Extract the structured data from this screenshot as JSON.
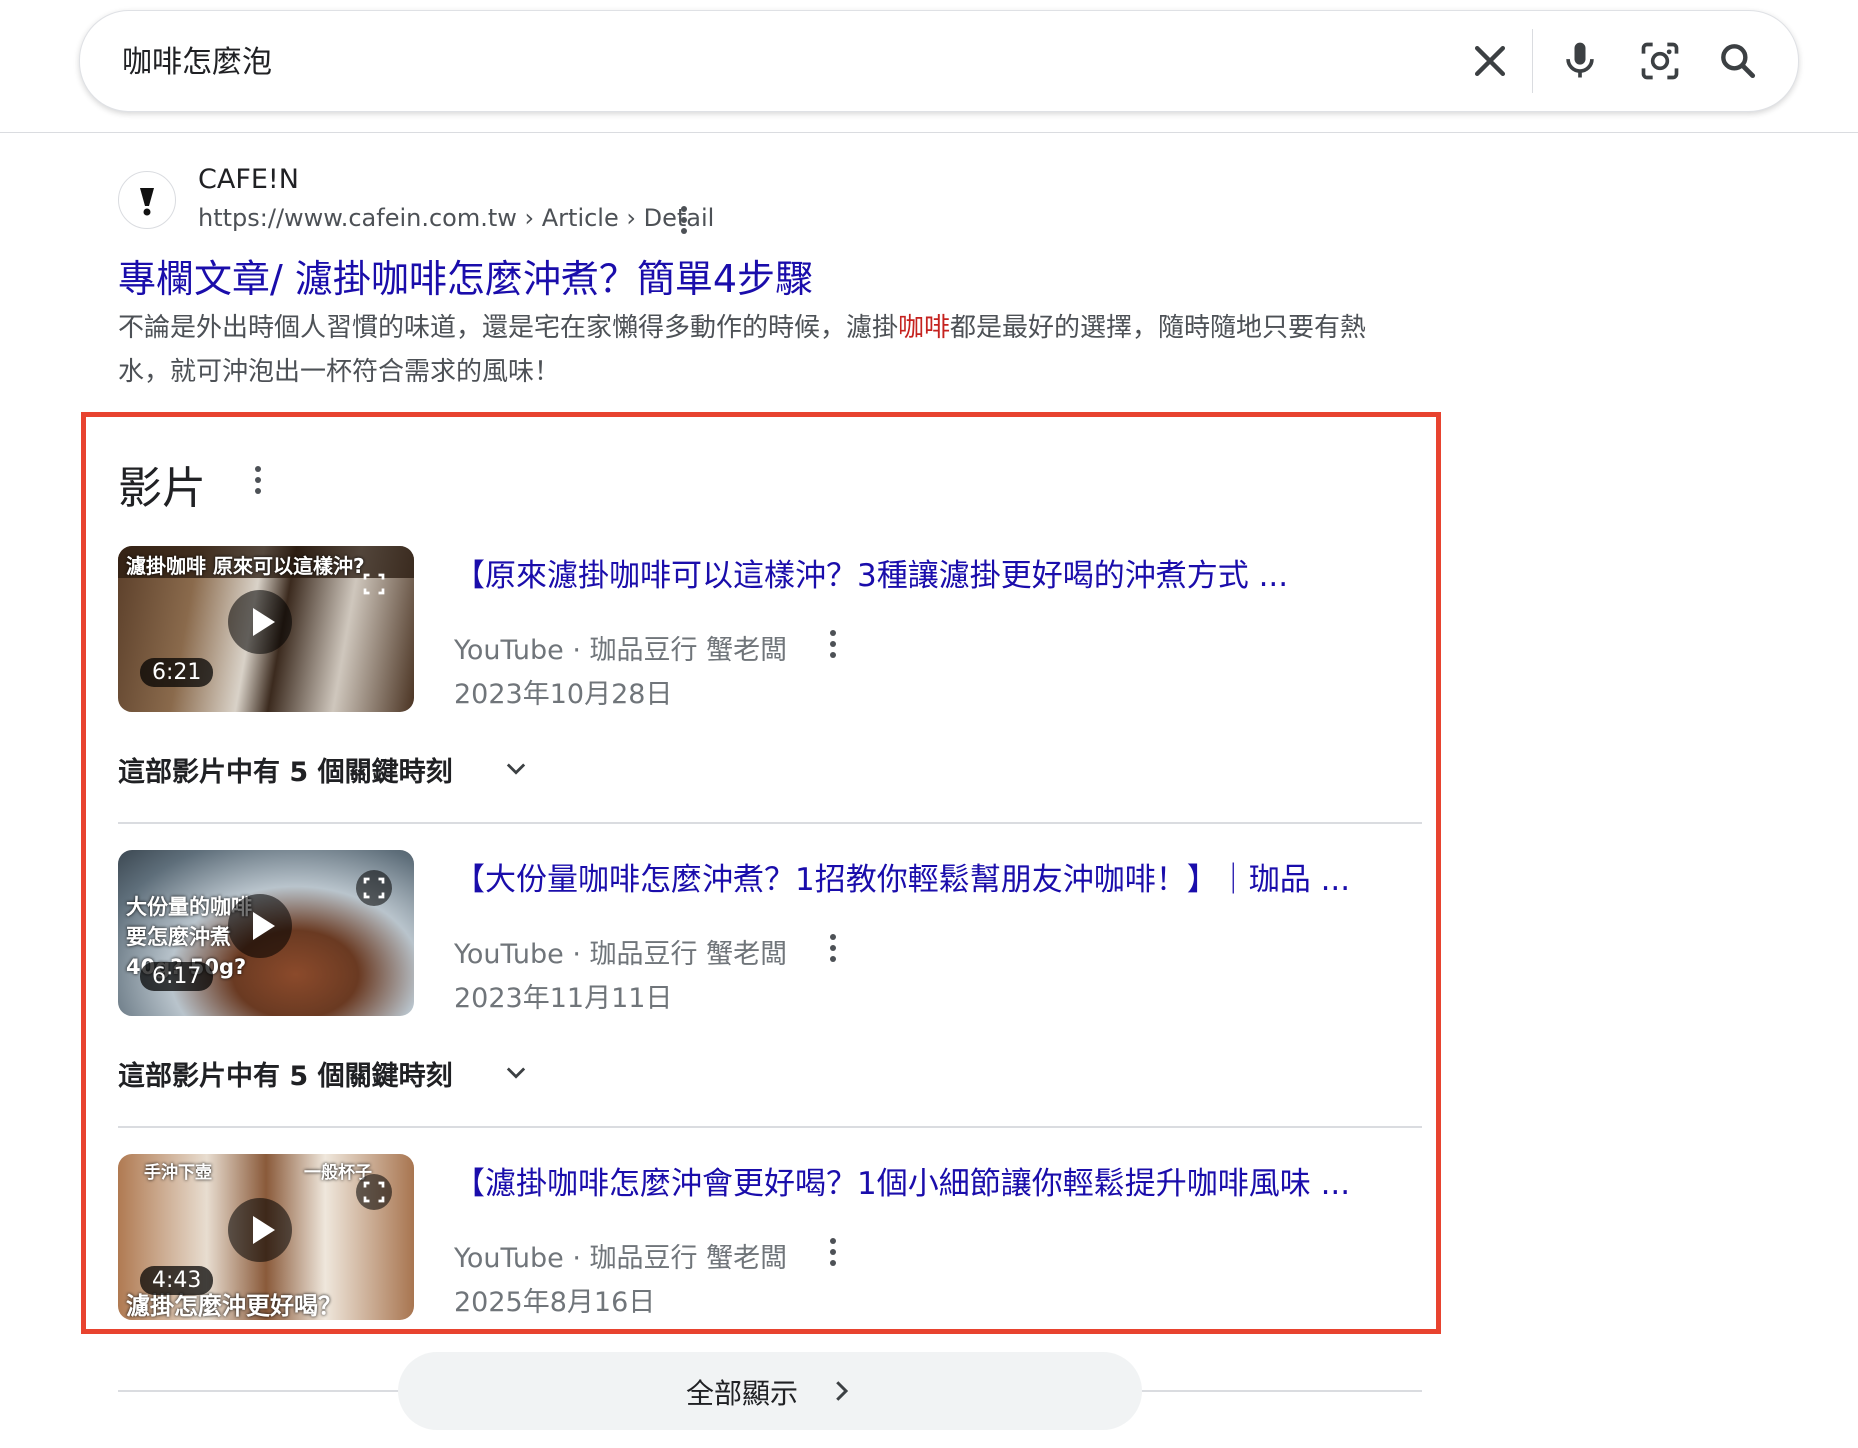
{
  "search": {
    "query": "咖啡怎麼泡"
  },
  "result": {
    "site_name": "CAFE!N",
    "site_url": "https://www.cafein.com.tw › Article › Detail",
    "title": "專欄文章/ 濾掛咖啡怎麼沖煮？簡單4步驟",
    "snippet_before": "不論是外出時個人習慣的味道，還是宅在家懶得多動作的時候，濾掛",
    "snippet_highlight": "咖啡",
    "snippet_after": "都是最好的選擇，隨時隨地只要有熱水，就可沖泡出一杯符合需求的風味！"
  },
  "videos_section": {
    "title": "影片",
    "items": [
      {
        "title": "【原來濾掛咖啡可以這樣沖？3種讓濾掛更好喝的沖煮方式 ...",
        "source": "YouTube · 珈品豆行 蟹老闆",
        "date": "2023年10月28日",
        "duration": "6:21",
        "thumb_caption": "濾掛咖啡  原來可以這樣沖?",
        "key_moments": "這部影片中有 5 個關鍵時刻"
      },
      {
        "title": "【大份量咖啡怎麼沖煮？1招教你輕鬆幫朋友沖咖啡！】｜珈品 ...",
        "source": "YouTube · 珈品豆行 蟹老闆",
        "date": "2023年11月11日",
        "duration": "6:17",
        "thumb_caption": "大份量的咖啡\n要怎麼沖煮\n40g? 50g?",
        "key_moments": "這部影片中有 5 個關鍵時刻"
      },
      {
        "title": "【濾掛咖啡怎麼沖會更好喝？1個小細節讓你輕鬆提升咖啡風味 ...",
        "source": "YouTube · 珈品豆行 蟹老闆",
        "date": "2025年8月16日",
        "duration": "4:43",
        "thumb_caption": "濾掛怎麼沖更好喝？",
        "thumb_tag_left": "手沖下壺",
        "thumb_tag_right": "一般杯子"
      }
    ],
    "show_all": "全部顯示"
  },
  "colors": {
    "link": "#1a0dab",
    "highlight_box": "#e8432f",
    "keyword": "#c5221f"
  }
}
